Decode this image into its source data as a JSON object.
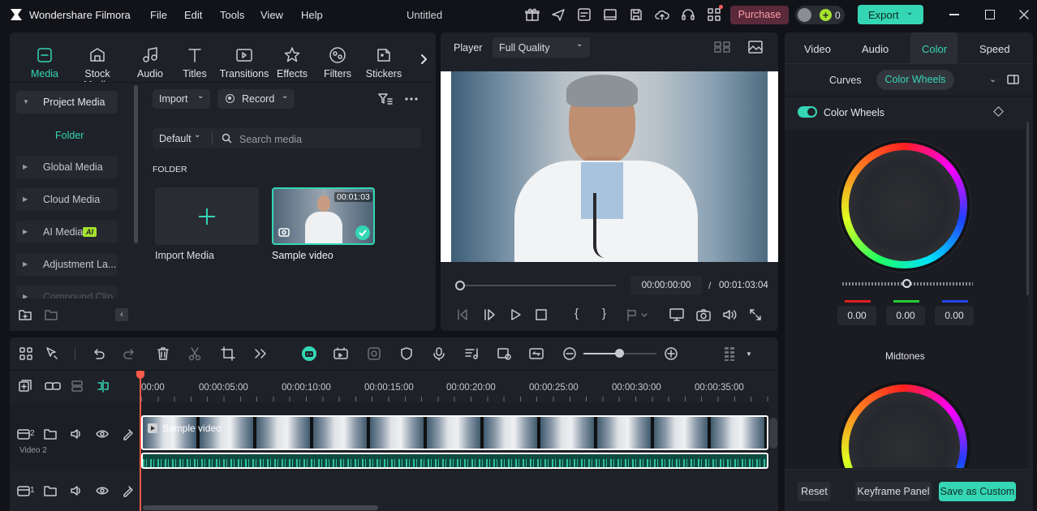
{
  "app": {
    "name": "Wondershare Filmora",
    "doc_title": "Untitled"
  },
  "menu": [
    "File",
    "Edit",
    "Tools",
    "View",
    "Help"
  ],
  "topbar": {
    "purchase": "Purchase",
    "credits": "0",
    "export": "Export"
  },
  "tools": [
    {
      "label": "Media",
      "icon": "media-icon",
      "active": true
    },
    {
      "label": "Stock Media",
      "icon": "stock-media-icon"
    },
    {
      "label": "Audio",
      "icon": "audio-icon"
    },
    {
      "label": "Titles",
      "icon": "titles-icon"
    },
    {
      "label": "Transitions",
      "icon": "transitions-icon"
    },
    {
      "label": "Effects",
      "icon": "effects-icon"
    },
    {
      "label": "Filters",
      "icon": "filters-icon"
    },
    {
      "label": "Stickers",
      "icon": "stickers-icon"
    }
  ],
  "sidebar": {
    "project_media": "Project Media",
    "folder": "Folder",
    "items": [
      "Global Media",
      "Cloud Media",
      "AI Media",
      "Adjustment La...",
      "Compound Clip"
    ],
    "ai_badge": "AI"
  },
  "media": {
    "import": "Import",
    "record": "Record",
    "sort": "Default",
    "search_placeholder": "Search media",
    "section": "FOLDER",
    "import_media": "Import Media",
    "clip_name": "Sample video",
    "clip_duration": "00:01:03"
  },
  "player": {
    "label": "Player",
    "quality": "Full Quality",
    "current_time": "00:00:00:00",
    "separator": "/",
    "total_time": "00:01:03:04",
    "progress": 0
  },
  "timeline": {
    "ruler": [
      "00:00",
      "00:00:05:00",
      "00:00:10:00",
      "00:00:15:00",
      "00:00:20:00",
      "00:00:25:00",
      "00:00:30:00",
      "00:00:35:00"
    ],
    "clip_label": "Sample video",
    "track2_num": "2",
    "track2_name": "Video 2",
    "track1_num": "1",
    "zoom": 0.5
  },
  "right": {
    "tabs": [
      "Video",
      "Audio",
      "Color",
      "Speed"
    ],
    "active_tab": "Color",
    "subtabs": [
      "Curves",
      "Color Wheels"
    ],
    "section": "Color Wheels",
    "values": [
      "0.00",
      "0.00",
      "0.00"
    ],
    "midtones": "Midtones",
    "reset": "Reset",
    "keyframe": "Keyframe Panel",
    "save": "Save as Custom"
  },
  "colors": {
    "accent": "#35d6b4",
    "purchase_bg": "#5a2a3a",
    "purchase_fg": "#ff9aa8",
    "red": "#e02020",
    "green": "#22cc33",
    "blue": "#2244ee"
  }
}
